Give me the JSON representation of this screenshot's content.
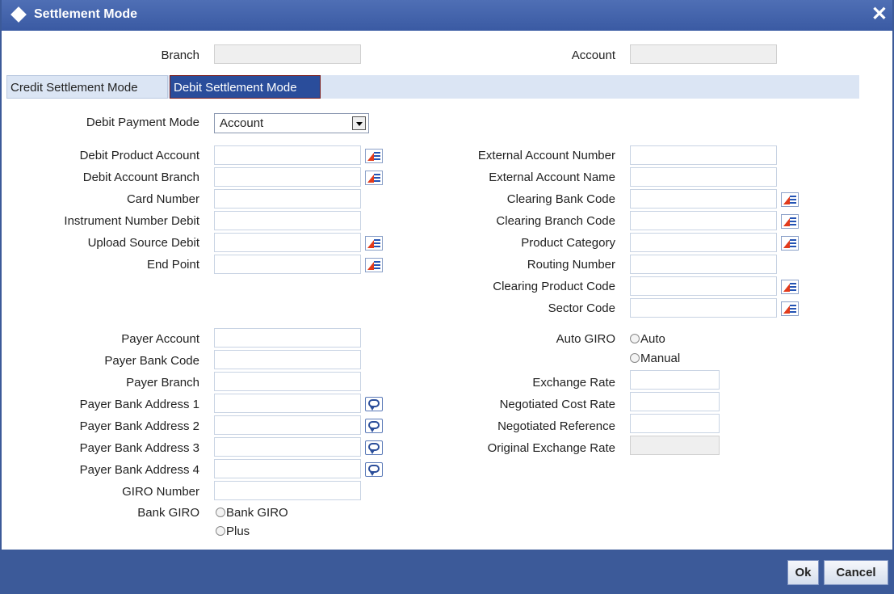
{
  "window": {
    "title": "Settlement Mode",
    "close_glyph": "✕"
  },
  "header": {
    "branch_label": "Branch",
    "account_label": "Account"
  },
  "tabs": [
    {
      "label": "Credit Settlement Mode",
      "active": false
    },
    {
      "label": "Debit Settlement Mode",
      "active": true
    }
  ],
  "debit": {
    "payment_mode_label": "Debit Payment Mode",
    "payment_mode_value": "Account",
    "product_account_label": "Debit Product Account",
    "account_branch_label": "Debit Account Branch",
    "card_number_label": "Card Number",
    "instrument_number_label": "Instrument Number Debit",
    "upload_source_label": "Upload Source Debit",
    "end_point_label": "End Point"
  },
  "external": {
    "account_number_label": "External Account Number",
    "account_name_label": "External Account Name",
    "clearing_bank_code_label": "Clearing Bank Code",
    "clearing_branch_code_label": "Clearing Branch Code",
    "product_category_label": "Product Category",
    "routing_number_label": "Routing Number",
    "clearing_product_code_label": "Clearing Product Code",
    "sector_code_label": "Sector Code"
  },
  "payer": {
    "account_label": "Payer Account",
    "bank_code_label": "Payer Bank Code",
    "branch_label": "Payer Branch",
    "address1_label": "Payer Bank Address 1",
    "address2_label": "Payer Bank Address 2",
    "address3_label": "Payer Bank Address 3",
    "address4_label": "Payer Bank Address 4",
    "giro_number_label": "GIRO Number",
    "bank_giro_label": "Bank GIRO",
    "bank_giro_options": [
      "Bank GIRO",
      "Plus"
    ]
  },
  "giro": {
    "auto_giro_label": "Auto GIRO",
    "auto_giro_options": [
      "Auto",
      "Manual"
    ]
  },
  "rates": {
    "exchange_rate_label": "Exchange Rate",
    "negotiated_cost_rate_label": "Negotiated Cost Rate",
    "negotiated_reference_label": "Negotiated Reference",
    "original_exchange_rate_label": "Original Exchange Rate"
  },
  "footer": {
    "ok_label": "Ok",
    "cancel_label": "Cancel"
  },
  "icons": {
    "title": "diamond-icon",
    "lov": "list-of-values-icon",
    "note": "speech-bubble-icon"
  },
  "colors": {
    "titlebar": "#3c5a99",
    "active_tab": "#2a4d9b",
    "tabstrip": "#dbe5f4"
  }
}
